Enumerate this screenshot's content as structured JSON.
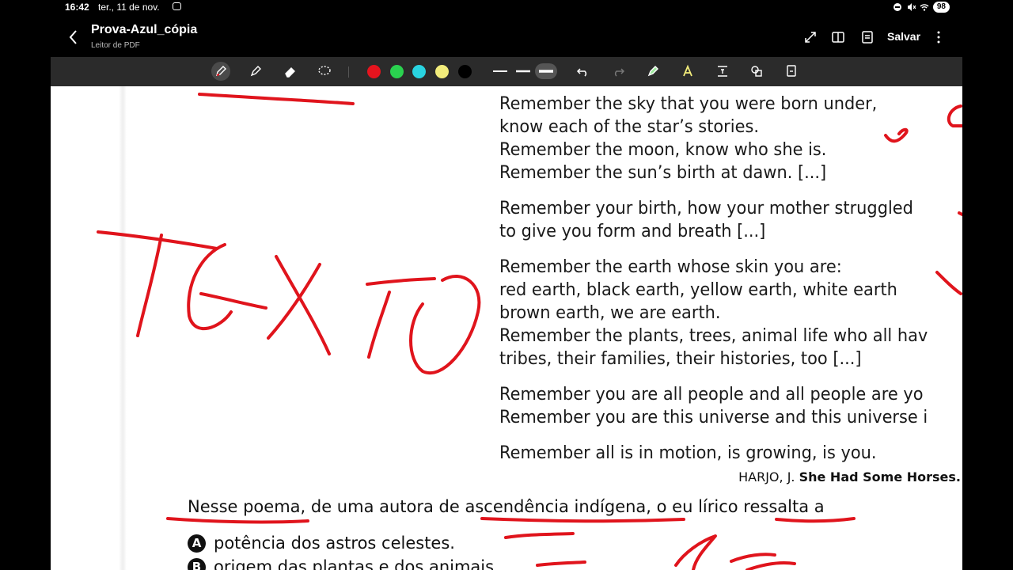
{
  "status": {
    "time": "16:42",
    "date": "ter., 11 de nov.",
    "battery": "98"
  },
  "app": {
    "title": "Prova-Azul_cópia",
    "subtitle": "Leitor de PDF",
    "save_label": "Salvar"
  },
  "toolbar": {
    "colors": [
      "#e5141e",
      "#2ad14f",
      "#29d3e0",
      "#f2ec7b",
      "#000000"
    ]
  },
  "poem": {
    "stanzas": [
      [
        "Remember the sky that you were born under,",
        "know each of the star’s stories.",
        "Remember the moon, know who she is.",
        "Remember the sun’s birth at dawn. [...]"
      ],
      [
        "Remember your birth, how your mother struggled",
        "to give you form and breath [...]"
      ],
      [
        "Remember the earth whose skin you are:",
        "red earth, black earth, yellow earth, white earth",
        "brown earth, we are earth.",
        "Remember the plants, trees, animal life who all hav",
        "tribes, their families, their histories, too [...]"
      ],
      [
        "Remember you are all people and all people are yo",
        "Remember you are this universe and this universe i"
      ],
      [
        "Remember all is in motion, is growing, is you."
      ]
    ],
    "citation_author": "HARJO, J.",
    "citation_title": "She Had Some Horses."
  },
  "question": {
    "part1": "Nesse poema",
    "part2": ", de uma autora de ",
    "part3": "ascendência indígena",
    "part4": ", o eu lírico ",
    "part5": "ressalta",
    "part6": " a"
  },
  "options": [
    {
      "letter": "A",
      "text": "potência dos astros celestes."
    },
    {
      "letter": "B",
      "text": "origem das plantas e dos animais."
    }
  ],
  "annotation": {
    "handwritten_word": "TEXTO"
  }
}
